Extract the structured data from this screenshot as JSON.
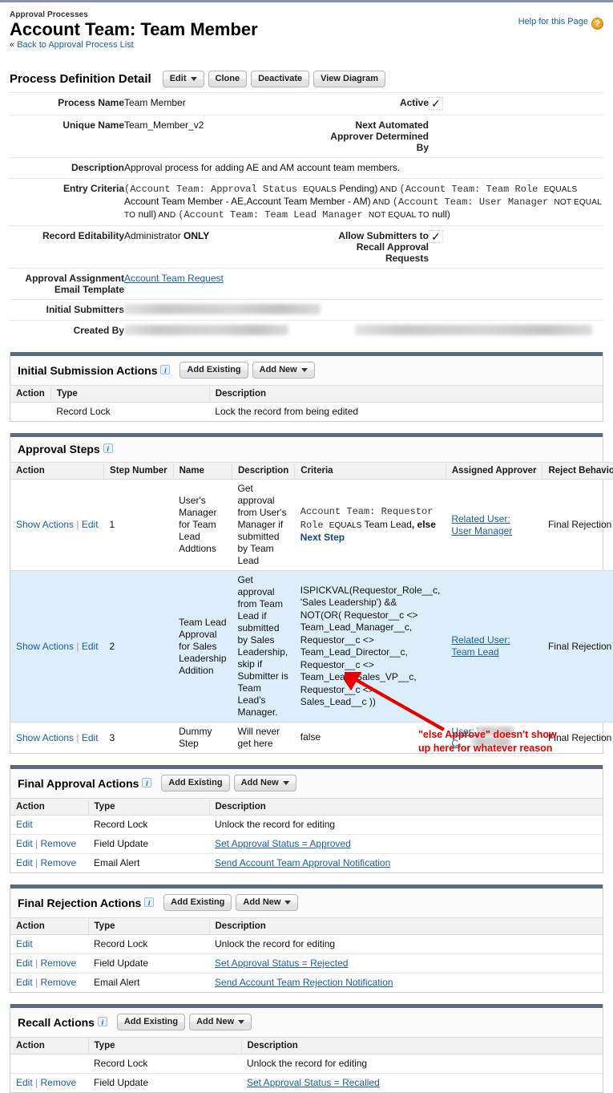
{
  "header": {
    "breadcrumb": "Approval Processes",
    "title": "Account Team: Team Member",
    "back_link": "Back to Approval Process List",
    "back_chevron": "«",
    "help_link": "Help for this Page",
    "help_badge": "?"
  },
  "detail": {
    "heading": "Process Definition Detail",
    "buttons": [
      {
        "label": "Edit",
        "has_caret": true
      },
      {
        "label": "Clone",
        "has_caret": false
      },
      {
        "label": "Deactivate",
        "has_caret": false
      },
      {
        "label": "View Diagram",
        "has_caret": false
      }
    ],
    "process_name_label": "Process Name",
    "process_name_value": "Team Member",
    "active_label": "Active",
    "active_checked": "✓",
    "unique_name_label": "Unique Name",
    "unique_name_value": "Team_Member_v2",
    "next_automated_label": "Next Automated Approver Determined By",
    "next_automated_value": "",
    "description_label": "Description",
    "description_value": "Approval process for adding AE and AM account team members.",
    "entry_criteria_label": "Entry Criteria",
    "entry_criteria_tokens": [
      {
        "t": "(",
        "k": "m"
      },
      {
        "t": "Account Team: Approval Status ",
        "k": "m"
      },
      {
        "t": "EQUALS",
        "k": "op"
      },
      {
        "t": " Pending)",
        "k": "v"
      },
      {
        "t": " AND ",
        "k": "op"
      },
      {
        "t": "(Account Team: Team Role ",
        "k": "m"
      },
      {
        "t": "EQUALS",
        "k": "op"
      },
      {
        "t": " Account Team Member - AE,Account Team Member - AM)",
        "k": "v"
      },
      {
        "t": " AND ",
        "k": "op"
      },
      {
        "t": "(Account Team: User Manager ",
        "k": "m"
      },
      {
        "t": "NOT EQUAL TO",
        "k": "op"
      },
      {
        "t": " null)",
        "k": "v"
      },
      {
        "t": " AND ",
        "k": "op"
      },
      {
        "t": "(Account Team: Team Lead Manager ",
        "k": "m"
      },
      {
        "t": "NOT EQUAL TO",
        "k": "op"
      },
      {
        "t": " null)",
        "k": "v"
      }
    ],
    "record_editability_label": "Record Editability",
    "record_editability_prefix": "Administrator ",
    "record_editability_strong": "ONLY",
    "allow_recall_label": "Allow Submitters to Recall Approval Requests",
    "allow_recall_checked": "✓",
    "email_template_label": "Approval Assignment Email Template",
    "email_template_value": "Account Team Request",
    "initial_submitters_label": "Initial Submitters",
    "initial_submitters_value": "",
    "created_by_label": "Created By",
    "created_by_value": ""
  },
  "initial_submission": {
    "title": "Initial Submission Actions",
    "info": "i",
    "buttons": [
      {
        "label": "Add Existing",
        "has_caret": false
      },
      {
        "label": "Add New",
        "has_caret": true
      }
    ],
    "columns": [
      "Action",
      "Type",
      "Description"
    ],
    "rows": [
      {
        "action": "",
        "type": "Record Lock",
        "description": "Lock the record from being edited",
        "link": false
      }
    ]
  },
  "approval_steps": {
    "title": "Approval Steps",
    "info": "i",
    "columns": [
      "Action",
      "Step Number",
      "Name",
      "Description",
      "Criteria",
      "Assigned Approver",
      "Reject Behavior"
    ],
    "rows": [
      {
        "show_actions": "Show Actions",
        "edit": "Edit",
        "step_number": "1",
        "name": "User's Manager for Team Lead Addtions",
        "description": "Get approval from User's Manager if submitted by Team Lead",
        "criteria_mono": "Account Team: Requestor Role ",
        "criteria_op": "EQUALS",
        "criteria_value": " Team Lead",
        "criteria_else": ", else",
        "criteria_next": "Next Step",
        "criteria_formula": "",
        "approver_line1": "Related User:",
        "approver_line2": "User Manager",
        "reject_behavior": "Final Rejection",
        "highlight": false
      },
      {
        "show_actions": "Show Actions",
        "edit": "Edit",
        "step_number": "2",
        "name": "Team Lead Approval for Sales Leadership Addition",
        "description": "Get approval from Team Lead if submitted by Sales Leadership, skip if Submitter is Team Lead's Manager.",
        "criteria_mono": "",
        "criteria_op": "",
        "criteria_value": "",
        "criteria_else": "",
        "criteria_next": "",
        "criteria_formula": "ISPICKVAL(Requestor_Role__c, 'Sales Leadership') && NOT(OR( Requestor__c <> Team_Lead_Manager__c, Requestor__c <> Team_Lead_Director__c, Requestor__c <> Team_Lead_Sales_VP__c, Requestor__c <> Sales_Lead__c ))",
        "approver_line1": "Related User:",
        "approver_line2": "Team Lead",
        "reject_behavior": "Final Rejection",
        "highlight": true
      },
      {
        "show_actions": "Show Actions",
        "edit": "Edit",
        "step_number": "3",
        "name": "Dummy Step",
        "description": "Will never get here",
        "criteria_mono": "",
        "criteria_op": "",
        "criteria_value": "",
        "criteria_else": "",
        "criteria_next": "",
        "criteria_formula": "false",
        "approver_line1": "User:J",
        "approver_line2": "C",
        "reject_behavior": "Final Rejection",
        "highlight": false
      }
    ]
  },
  "final_approval": {
    "title": "Final Approval Actions",
    "info": "i",
    "buttons": [
      {
        "label": "Add Existing",
        "has_caret": false
      },
      {
        "label": "Add New",
        "has_caret": true
      }
    ],
    "columns": [
      "Action",
      "Type",
      "Description"
    ],
    "rows": [
      {
        "edit": "Edit",
        "remove": "",
        "type": "Record Lock",
        "description": "Unlock the record for editing",
        "link": false
      },
      {
        "edit": "Edit",
        "remove": "Remove",
        "type": "Field Update",
        "description": "Set Approval Status = Approved",
        "link": true
      },
      {
        "edit": "Edit",
        "remove": "Remove",
        "type": "Email Alert",
        "description": "Send Account Team Approval Notification",
        "link": true
      }
    ]
  },
  "final_rejection": {
    "title": "Final Rejection Actions",
    "info": "i",
    "buttons": [
      {
        "label": "Add Existing",
        "has_caret": false
      },
      {
        "label": "Add New",
        "has_caret": true
      }
    ],
    "columns": [
      "Action",
      "Type",
      "Description"
    ],
    "rows": [
      {
        "edit": "Edit",
        "remove": "",
        "type": "Record Lock",
        "description": "Unlock the record for editing",
        "link": false
      },
      {
        "edit": "Edit",
        "remove": "Remove",
        "type": "Field Update",
        "description": "Set Approval Status = Rejected",
        "link": true
      },
      {
        "edit": "Edit",
        "remove": "Remove",
        "type": "Email Alert",
        "description": "Send Account Team Rejection Notification",
        "link": true
      }
    ]
  },
  "recall": {
    "title": "Recall Actions",
    "info": "i",
    "buttons": [
      {
        "label": "Add Existing",
        "has_caret": false
      },
      {
        "label": "Add New",
        "has_caret": true
      }
    ],
    "columns": [
      "Action",
      "Type",
      "Description"
    ],
    "rows": [
      {
        "edit": "",
        "remove": "",
        "type": "Record Lock",
        "description": "Unlock the record for editing",
        "link": false
      },
      {
        "edit": "Edit",
        "remove": "Remove",
        "type": "Field Update",
        "description": "Set Approval Status = Recalled",
        "link": true
      }
    ]
  },
  "annotation": {
    "line1": "\"else Approve\" doesn't show",
    "line2": "up here for whatever reason",
    "color": "#e60000"
  },
  "colors": {
    "link": "#1b5fa5",
    "section_bar": "#5c6b84",
    "highlight_row": "#ddeefb",
    "annotation": "#e60000"
  }
}
